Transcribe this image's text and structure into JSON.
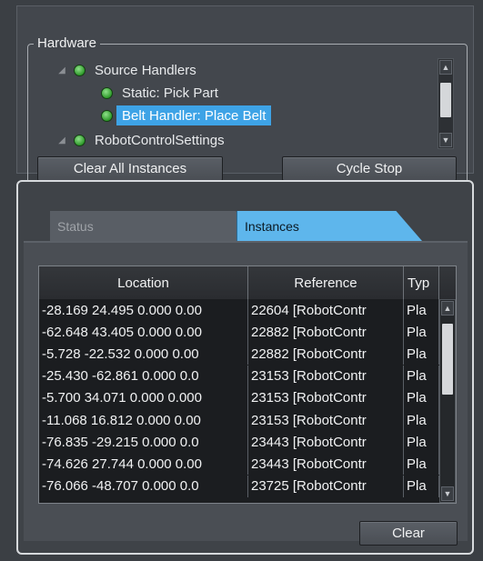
{
  "hardware": {
    "group_title": "Hardware",
    "tree": [
      {
        "label": "Source Handlers",
        "selected": false
      },
      {
        "label": "Static: Pick Part",
        "selected": false
      },
      {
        "label": "Belt Handler: Place Belt",
        "selected": true
      },
      {
        "label": "RobotControlSettings",
        "selected": false
      }
    ],
    "clear_all_label": "Clear All Instances",
    "cycle_stop_label": "Cycle Stop"
  },
  "tabs": [
    {
      "label": "Status",
      "active": false
    },
    {
      "label": "Instances",
      "active": true
    }
  ],
  "instances_table": {
    "columns": [
      "Location",
      "Reference",
      "Typ"
    ],
    "rows": [
      [
        "-28.169 24.495 0.000 0.00",
        "22604 [RobotContr",
        "Pla"
      ],
      [
        "-62.648 43.405 0.000 0.00",
        "22882 [RobotContr",
        "Pla"
      ],
      [
        "-5.728 -22.532 0.000 0.00",
        "22882 [RobotContr",
        "Pla"
      ],
      [
        "-25.430 -62.861 0.000 0.0",
        "23153 [RobotContr",
        "Pla"
      ],
      [
        "-5.700 34.071 0.000 0.000",
        "23153 [RobotContr",
        "Pla"
      ],
      [
        "-11.068 16.812 0.000 0.00",
        "23153 [RobotContr",
        "Pla"
      ],
      [
        "-76.835 -29.215 0.000 0.0",
        "23443 [RobotContr",
        "Pla"
      ],
      [
        "-74.626 27.744 0.000 0.00",
        "23443 [RobotContr",
        "Pla"
      ],
      [
        "-76.066 -48.707 0.000 0.0",
        "23725 [RobotContr",
        "Pla"
      ]
    ]
  },
  "clear_label": "Clear",
  "icons": {
    "status_led": "green-led-icon",
    "expander": "collapse-triangle-icon",
    "scroll_up": "chevron-up-icon",
    "scroll_down": "chevron-down-icon"
  },
  "colors": {
    "selection": "#3ea3e6",
    "active_tab": "#5eb6ec",
    "led": "#2f9a2b"
  }
}
